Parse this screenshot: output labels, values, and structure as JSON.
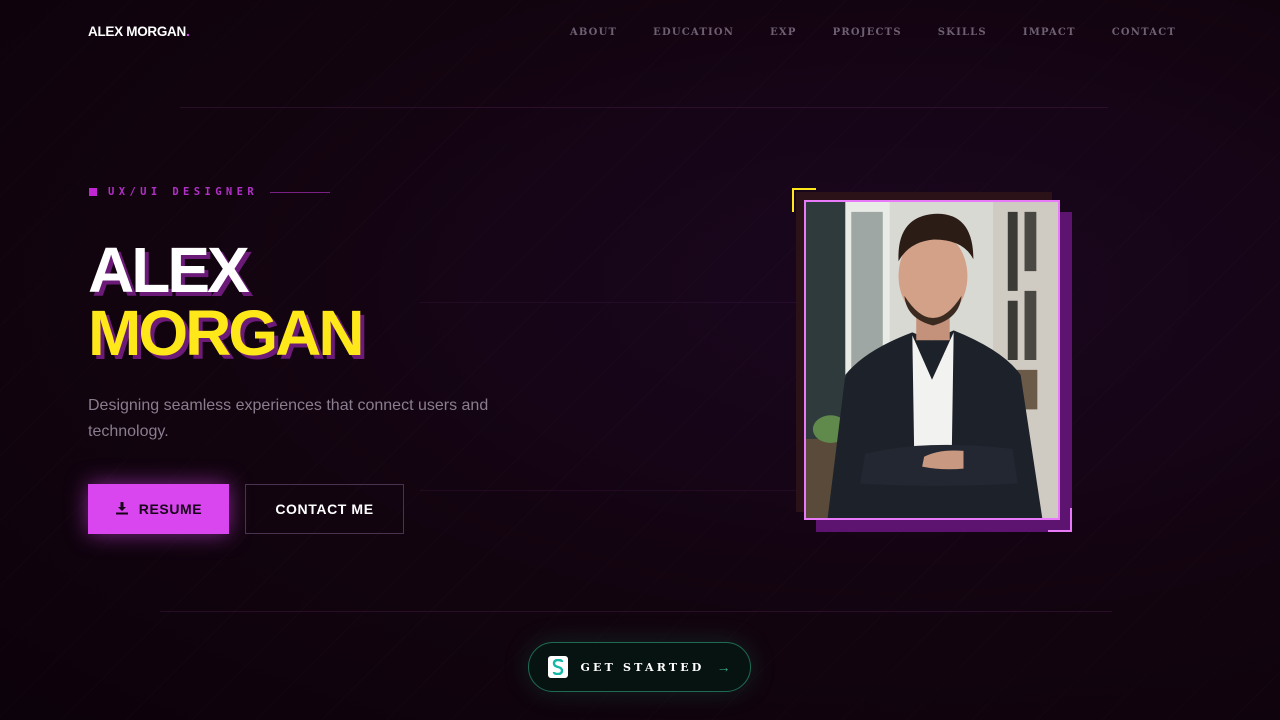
{
  "brand": {
    "name": "ALEX MORGAN",
    "accent_dot": "."
  },
  "nav": {
    "items": [
      {
        "label": "ABOUT"
      },
      {
        "label": "EDUCATION"
      },
      {
        "label": "EXP"
      },
      {
        "label": "PROJECTS"
      },
      {
        "label": "SKILLS"
      },
      {
        "label": "IMPACT"
      },
      {
        "label": "CONTACT"
      }
    ]
  },
  "hero": {
    "eyebrow": "UX/UI DESIGNER",
    "first_name": "ALEX",
    "last_name": "MORGAN",
    "tagline": "Designing seamless experiences that connect users and technology.",
    "resume_label": "RESUME",
    "contact_label": "CONTACT ME"
  },
  "cta": {
    "label": "GET STARTED",
    "arrow": "→",
    "logo_icon": "s-logo-icon"
  },
  "icons": {
    "resume": "download-icon",
    "portrait": "portrait-photo"
  },
  "colors": {
    "background": "#10030f",
    "accent_magenta": "#d946ef",
    "accent_yellow": "#ffe81a",
    "cta_green": "#1e6b52"
  }
}
